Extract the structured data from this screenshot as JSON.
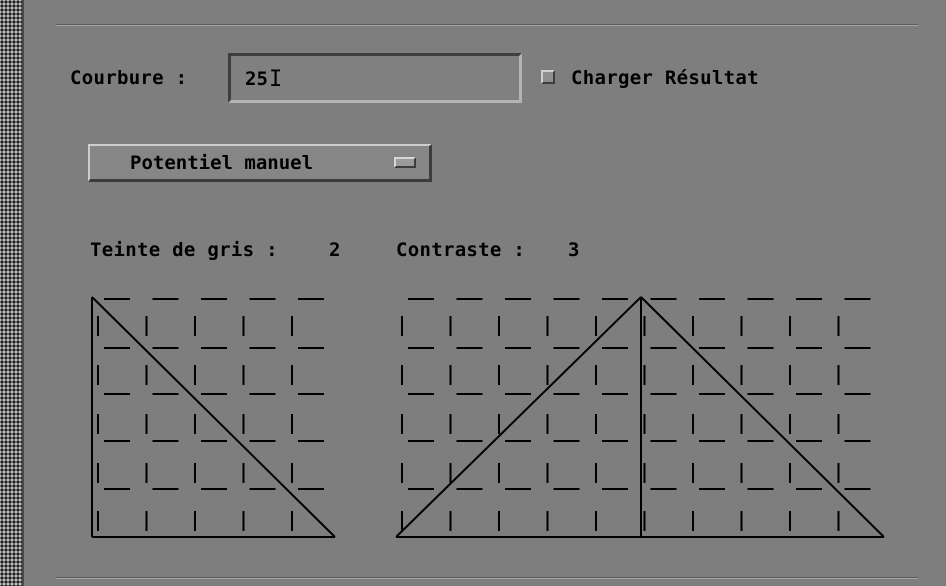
{
  "form": {
    "courbure_label": "Courbure :",
    "courbure_value": "25",
    "charger_resultat_label": "Charger Résultat",
    "charger_resultat_checked": false,
    "potentiel_option": "Potentiel manuel"
  },
  "grey": {
    "teinte_label": "Teinte de gris :",
    "teinte_value": "2",
    "contraste_label": "Contraste :",
    "contraste_value": "3"
  },
  "icons": {
    "option_menu": "option-menu-indicator-icon",
    "checkbox": "toggle-checkbox-icon"
  },
  "colors": {
    "background": "#7e7e7e",
    "text": "#000000",
    "stipple_dark": "#1a1a1a",
    "stipple_light": "#c9c9c9"
  }
}
